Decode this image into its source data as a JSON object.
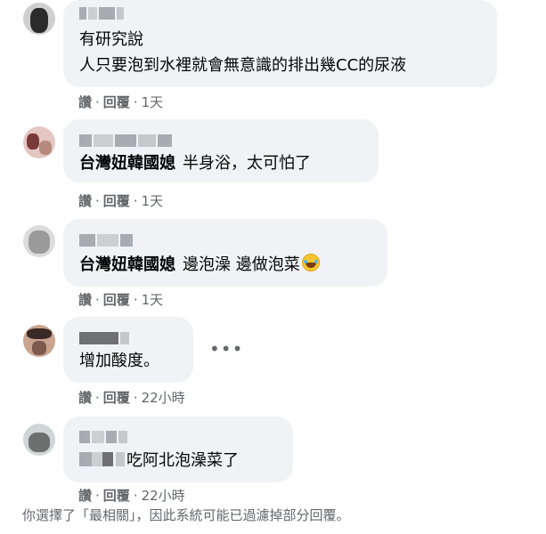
{
  "actions": {
    "like": "讚",
    "reply": "回覆",
    "separator": "·"
  },
  "comments": [
    {
      "lines": [
        "有研究說",
        "人只要泡到水裡就會無意識的排出幾CC的尿液"
      ],
      "time": "1天"
    },
    {
      "tag": "台灣妞韓國媳",
      "text": "半身浴，太可怕了",
      "time": "1天"
    },
    {
      "tag": "台灣妞韓國媳",
      "text": "邊泡澡 邊做泡菜",
      "time": "1天"
    },
    {
      "text": "增加酸度。",
      "time": "22小時",
      "more": "•••"
    },
    {
      "text": "吃阿北泡澡菜了",
      "time": "22小時"
    }
  ],
  "footer": "你選擇了「最相關」，因此系統可能已過濾掉部分回覆。"
}
